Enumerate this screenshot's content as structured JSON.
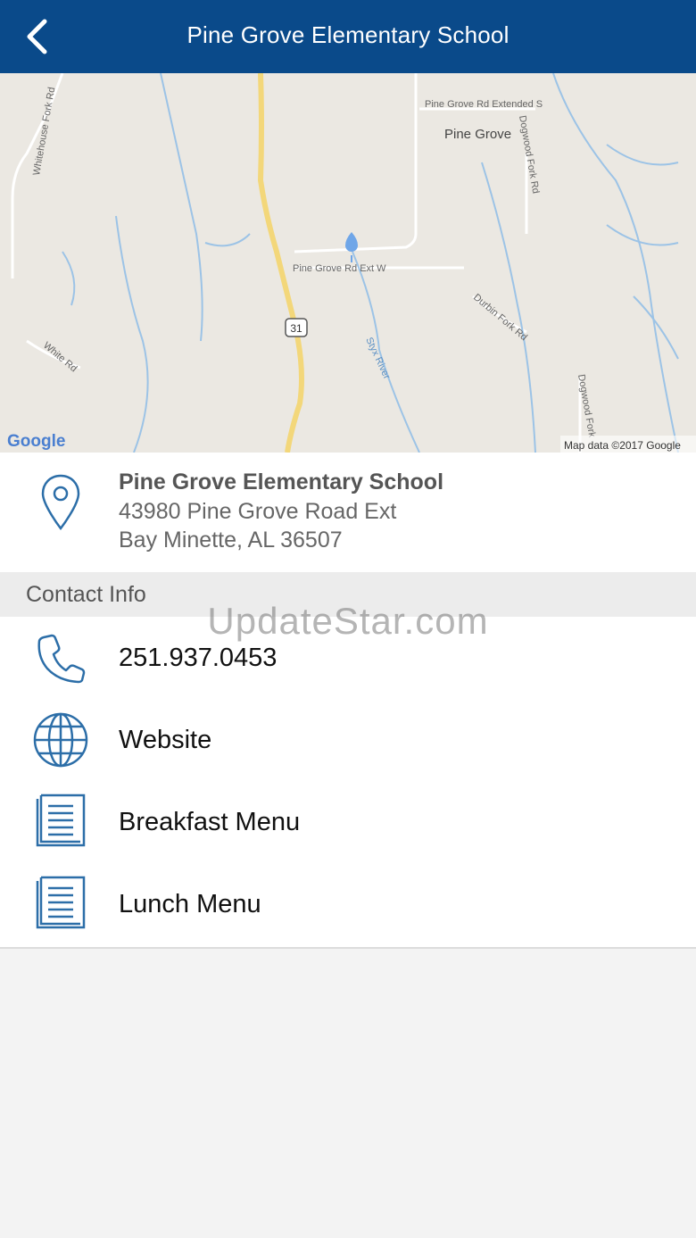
{
  "header": {
    "title": "Pine Grove Elementary School",
    "back_icon": "chevron-left-icon",
    "color": "#0a4a8a"
  },
  "map": {
    "labels": {
      "whitehouse_fork_rd": "Whitehouse Fork Rd",
      "pine_grove_rd_extended_s": "Pine Grove Rd Extended S",
      "pine_grove": "Pine Grove",
      "dogwood_fork_rd_top": "Dogwood Fork Rd",
      "pine_grove_rd_ext_w": "Pine Grove Rd Ext W",
      "route_31": "31",
      "durbin_fork_rd": "Durbin Fork Rd",
      "white_rd": "White Rd",
      "styx_river": "Styx River",
      "dogwood_fork_bottom": "Dogwood Fork",
      "google_logo": "Google",
      "attribution": "Map data ©2017 Google"
    }
  },
  "location": {
    "icon": "map-pin-icon",
    "name": "Pine Grove Elementary School",
    "address_line1": "43980 Pine Grove Road Ext",
    "address_line2": "Bay Minette, AL 36507"
  },
  "contact_section": {
    "title": "Contact Info"
  },
  "contacts": [
    {
      "icon": "phone-icon",
      "label": "251.937.0453"
    },
    {
      "icon": "globe-icon",
      "label": "Website"
    },
    {
      "icon": "document-icon",
      "label": "Breakfast Menu"
    },
    {
      "icon": "document-icon",
      "label": "Lunch Menu"
    }
  ],
  "watermark": "UpdateStar.com",
  "colors": {
    "accent": "#2c6ea8",
    "header": "#0a4a8a",
    "road_major": "#f3d77a",
    "water": "#8ab8e0"
  }
}
